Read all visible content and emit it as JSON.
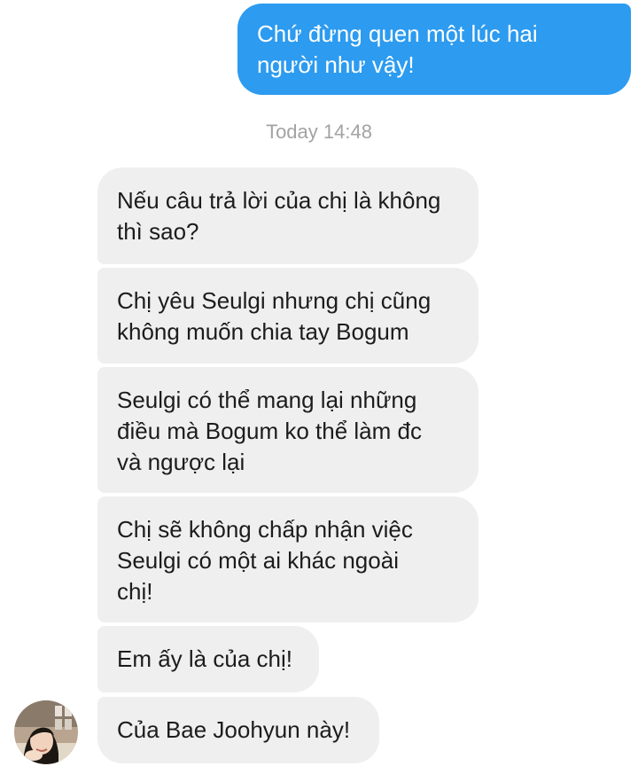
{
  "conversation": {
    "outgoing_message": "Chứ đừng quen một lúc hai\nngười như vậy!",
    "timestamp": "Today 14:48",
    "incoming_messages": [
      "Nếu câu trả lời của chị là không\nthì sao?",
      "Chị yêu Seulgi nhưng chị cũng\nkhông muốn chia tay Bogum",
      "Seulgi có thể mang lại những\nđiều mà Bogum ko thể làm đc\nvà ngược lại",
      "Chị sẽ không chấp nhận việc\nSeulgi có một ai khác ngoài\nchị!",
      "Em ấy là của chị!",
      "Của Bae Joohyun này!"
    ]
  },
  "colors": {
    "outgoing_bubble": "#2c9bf0",
    "incoming_bubble": "#efefef",
    "timestamp_text": "#a3a3a3"
  },
  "icons": {
    "sender_avatar": "contact-avatar-photo"
  }
}
